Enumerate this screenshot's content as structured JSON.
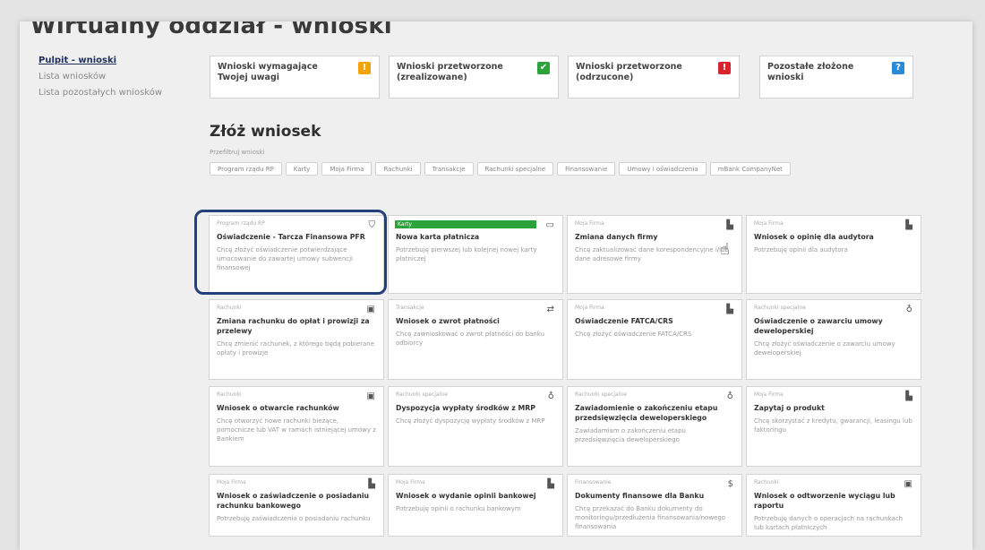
{
  "page": {
    "title": "Wirtualny oddział - wnioski"
  },
  "sidebar": {
    "items": [
      {
        "label": "Pulpit - wnioski"
      },
      {
        "label": "Lista wniosków"
      },
      {
        "label": "Lista pozostałych wniosków"
      }
    ]
  },
  "stats": [
    {
      "label": "Wnioski wymagające Twojej uwagi",
      "badge": "!",
      "color": "#f0a30a",
      "icon": "exclamation-icon"
    },
    {
      "label": "Wnioski przetworzone (zrealizowane)",
      "badge": "✔",
      "color": "#2ca33d",
      "icon": "check-icon"
    },
    {
      "label": "Wnioski przetworzone (odrzucone)",
      "badge": "!",
      "color": "#d9232d",
      "icon": "alert-icon"
    },
    {
      "label": "Pozostałe złożone wnioski",
      "badge": "?",
      "color": "#2a8ad6",
      "icon": "question-icon"
    }
  ],
  "section": {
    "title": "Złóż wniosek",
    "filter_label": "Przefiltruj wnioski"
  },
  "filters": [
    "Program rządu RP",
    "Karty",
    "Moja Firma",
    "Rachunki",
    "Transakcje",
    "Rachunki specjalne",
    "Finansowanie",
    "Umowy i oświadczenia",
    "mBank CompanyNet"
  ],
  "cards": [
    {
      "category": "Program rządu RP",
      "title": "Oświadczenie - Tarcza Finansowa PFR",
      "desc": "Chcę złożyć oświadczenie potwierdzające umocowanie do zawartej umowy subwencji finansowej",
      "icon": "shield-icon"
    },
    {
      "category": "Karty",
      "title": "Nowa karta płatnicza",
      "desc": "Potrzebuję pierwszej lub kolejnej nowej karty płatniczej",
      "icon": "card-icon"
    },
    {
      "category": "Moja Firma",
      "title": "Zmiana danych firmy",
      "desc": "Chcę zaktualizować dane korespondencyjne i/lub dane adresowe firmy",
      "icon": "building-icon"
    },
    {
      "category": "Moja Firma",
      "title": "Wniosek o opinię dla audytora",
      "desc": "Potrzebuję opinii dla audytora",
      "icon": "building-icon"
    },
    {
      "category": "Rachunki",
      "title": "Zmiana rachunku do opłat i prowizji za przelewy",
      "desc": "Chcę zmienić rachunek, z którego będą pobierane opłaty i prowizje",
      "icon": "wallet-icon"
    },
    {
      "category": "Transakcje",
      "title": "Wniosek o zwrot płatności",
      "desc": "Chcę zawnioskować o zwrot płatności do banku odbiorcy",
      "icon": "transfer-icon"
    },
    {
      "category": "Moja Firma",
      "title": "Oświadczenie FATCA/CRS",
      "desc": "Chcę złożyć oświadczenie FATCA/CRS",
      "icon": "building-icon"
    },
    {
      "category": "Rachunki specjalne",
      "title": "Oświadczenie o zawarciu umowy deweloperskiej",
      "desc": "Chcę złożyć oświadczenie o zawarciu umowy deweloperskiej",
      "icon": "award-icon"
    },
    {
      "category": "Rachunki",
      "title": "Wniosek o otwarcie rachunków",
      "desc": "Chcę otworzyć nowe rachunki bieżące, pomocnicze lub VAT w ramach istniejącej umowy z Bankiem",
      "icon": "wallet-icon"
    },
    {
      "category": "Rachunki specjalne",
      "title": "Dyspozycja wypłaty środków z MRP",
      "desc": "Chcę złożyć dyspozycję wypłaty środków z MRP",
      "icon": "award-icon"
    },
    {
      "category": "Rachunki specjalne",
      "title": "Zawiadomienie o zakończeniu etapu przedsięwzięcia deweloperskiego",
      "desc": "Zawiadamiam o zakończeniu etapu przedsięwzięcia deweloperskiego",
      "icon": "award-icon"
    },
    {
      "category": "Moja Firma",
      "title": "Zapytaj o produkt",
      "desc": "Chcę skorzystać z kredytu, gwarancji, leasingu lub faktoringu",
      "icon": "building-icon"
    },
    {
      "category": "Moja Firma",
      "title": "Wniosek o zaświadczenie o posiadaniu rachunku bankowego",
      "desc": "Potrzebuję zaświadczenia o posiadaniu rachunku",
      "icon": "building-icon"
    },
    {
      "category": "Moja Firma",
      "title": "Wniosek o wydanie opinii bankowej",
      "desc": "Potrzebuję opinii o rachunku bankowym",
      "icon": "building-icon"
    },
    {
      "category": "Finansowanie",
      "title": "Dokumenty finansowe dla Banku",
      "desc": "Chcę przekazać do Banku dokumenty do monitoringu/przedłużenia finansowania/nowego finansowania",
      "icon": "money-icon"
    },
    {
      "category": "Rachunki",
      "title": "Wniosek o odtworzenie wyciągu lub raportu",
      "desc": "Potrzebuję danych o operacjach na rachunkach lub kartach płatniczych",
      "icon": "wallet-icon"
    }
  ]
}
